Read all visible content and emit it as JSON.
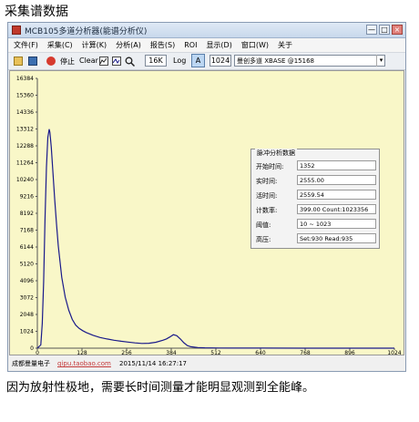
{
  "heading": "采集谱数据",
  "caption": "因为放射性极地，需要长时间测量才能明显观测到全能峰。",
  "window": {
    "title": "MCB105多道分析器(能谱分析仪)",
    "buttons": {
      "minimize": "—",
      "maximize": "□",
      "close": "×"
    }
  },
  "menu": [
    "文件(F)",
    "采集(C)",
    "计算(K)",
    "分析(A)",
    "报告(S)",
    "ROI",
    "显示(D)",
    "窗口(W)",
    "关于"
  ],
  "toolbar": {
    "stop_label": "停止",
    "clear_label": "Clear",
    "range_value": "16K",
    "log_label": "Log",
    "a_label": "A",
    "channels_value": "1024",
    "device_value": "曼创多道 XBASE @15168",
    "icons": [
      "folder-open-icon",
      "save-icon",
      "record-icon",
      "chart-icon",
      "chart-fit-icon",
      "zoom-icon"
    ]
  },
  "chart_data": {
    "type": "line",
    "xlim": [
      0,
      1024
    ],
    "ylim": [
      0,
      16384
    ],
    "x_ticks": [
      0,
      128,
      256,
      384,
      512,
      640,
      768,
      896,
      1024
    ],
    "y_ticks": [
      0,
      1024,
      2048,
      3072,
      4096,
      5120,
      6144,
      7168,
      8192,
      9216,
      10240,
      11264,
      12288,
      13312,
      14336,
      15360,
      16384
    ],
    "grid": false,
    "line_color": "#1a1a8a",
    "series": [
      {
        "x": [
          0,
          10,
          14,
          18,
          22,
          26,
          30,
          34,
          36,
          40,
          45,
          50,
          55,
          60,
          70,
          80,
          90,
          100,
          110,
          120,
          130,
          140,
          160,
          180,
          200,
          220,
          240,
          260,
          280,
          300,
          320,
          340,
          360,
          370,
          380,
          390,
          400,
          410,
          420,
          430,
          440,
          460,
          480,
          520,
          560,
          640,
          768,
          896,
          1024
        ],
        "y": [
          0,
          200,
          1500,
          4000,
          7800,
          11000,
          12800,
          13300,
          13100,
          12200,
          10600,
          9000,
          7500,
          6200,
          4300,
          3100,
          2300,
          1750,
          1400,
          1200,
          1060,
          950,
          780,
          650,
          560,
          480,
          420,
          370,
          320,
          290,
          300,
          360,
          480,
          560,
          680,
          820,
          760,
          560,
          330,
          160,
          90,
          40,
          20,
          10,
          5,
          3,
          2,
          2,
          2
        ]
      }
    ]
  },
  "info_panel": {
    "title": "脉冲分析数据",
    "rows": [
      {
        "label": "开始时间:",
        "value": "1352"
      },
      {
        "label": "实时间:",
        "value": "2555.00"
      },
      {
        "label": "活时间:",
        "value": "2559.54"
      },
      {
        "label": "计数率:",
        "value": "399.00 Count:1023356"
      },
      {
        "label": "阈值:",
        "value": "10   ~ 1023"
      },
      {
        "label": "高压:",
        "value": "Set:930 Read:935"
      }
    ]
  },
  "status": {
    "company": "成都曼量电子",
    "link": "qipu.taobao.com",
    "datetime": "2015/11/14 16:27:17"
  }
}
